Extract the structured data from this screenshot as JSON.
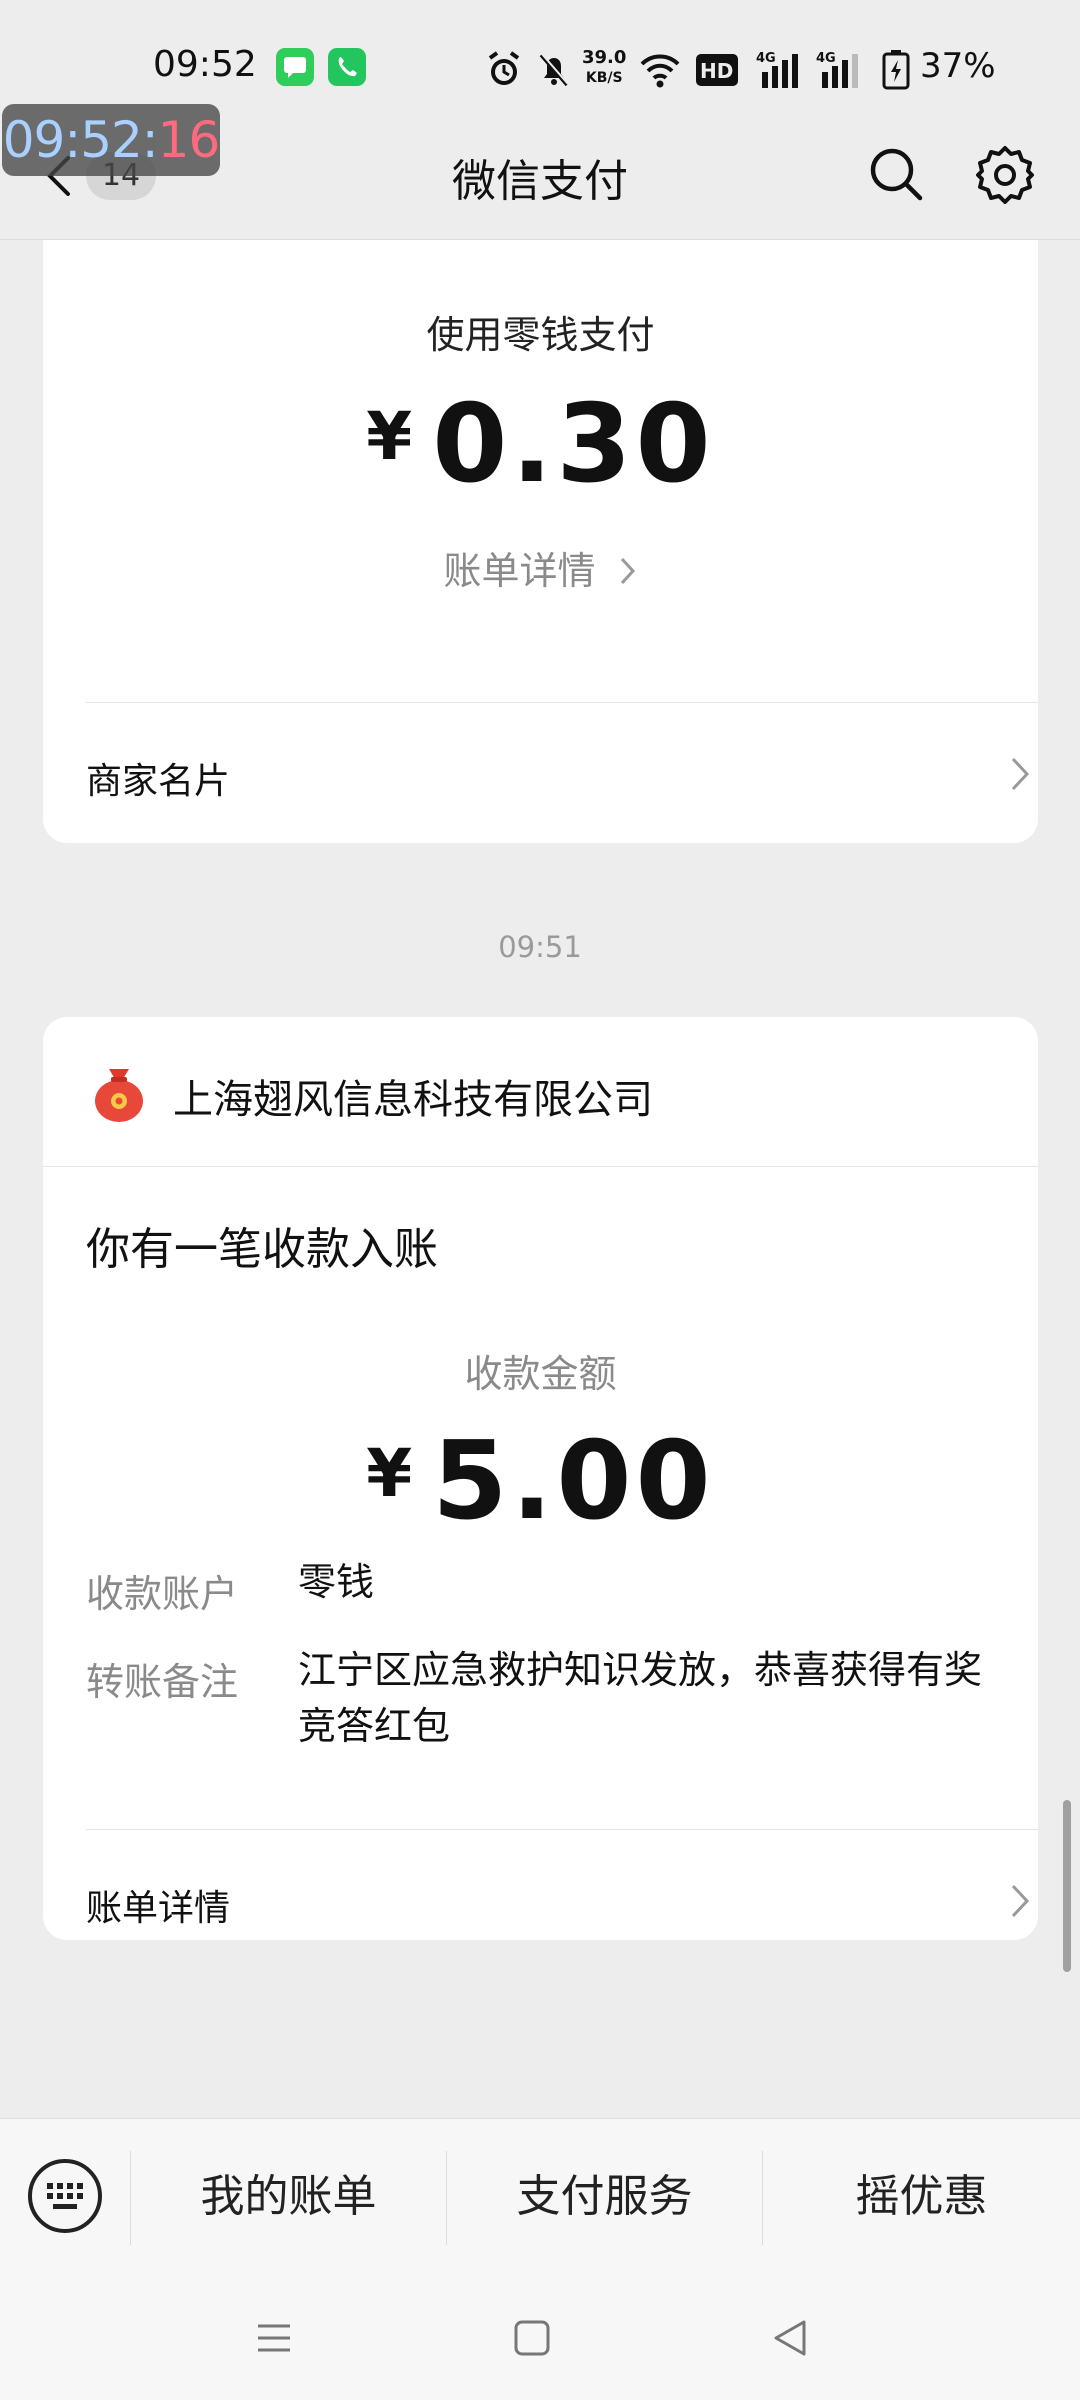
{
  "status_bar": {
    "time": "09:52",
    "net_speed_value": "39.0",
    "net_speed_unit": "KB/S",
    "network": "4G",
    "battery": "37%"
  },
  "overlay_clock": {
    "hm": "09:52:",
    "s": "16"
  },
  "header": {
    "back_count": "14",
    "title": "微信支付"
  },
  "card1": {
    "pay_method": "使用零钱支付",
    "currency": "¥",
    "amount": "0.30",
    "detail_link": "账单详情",
    "merchant_card_label": "商家名片"
  },
  "timestamp": "09:51",
  "card2": {
    "merchant_name": "上海翅风信息科技有限公司",
    "headline": "你有一笔收款入账",
    "amount_label": "收款金额",
    "currency": "¥",
    "amount": "5.00",
    "account_key": "收款账户",
    "account_value": "零钱",
    "note_key": "转账备注",
    "note_value": "江宁区应急救护知识发放，恭喜获得有奖竞答红包",
    "detail_label": "账单详情"
  },
  "bottom_menu": {
    "items": [
      "我的账单",
      "支付服务",
      "摇优惠"
    ]
  },
  "colors": {
    "background": "#ededed",
    "card": "#ffffff",
    "muted_text": "#8a8a8a"
  }
}
